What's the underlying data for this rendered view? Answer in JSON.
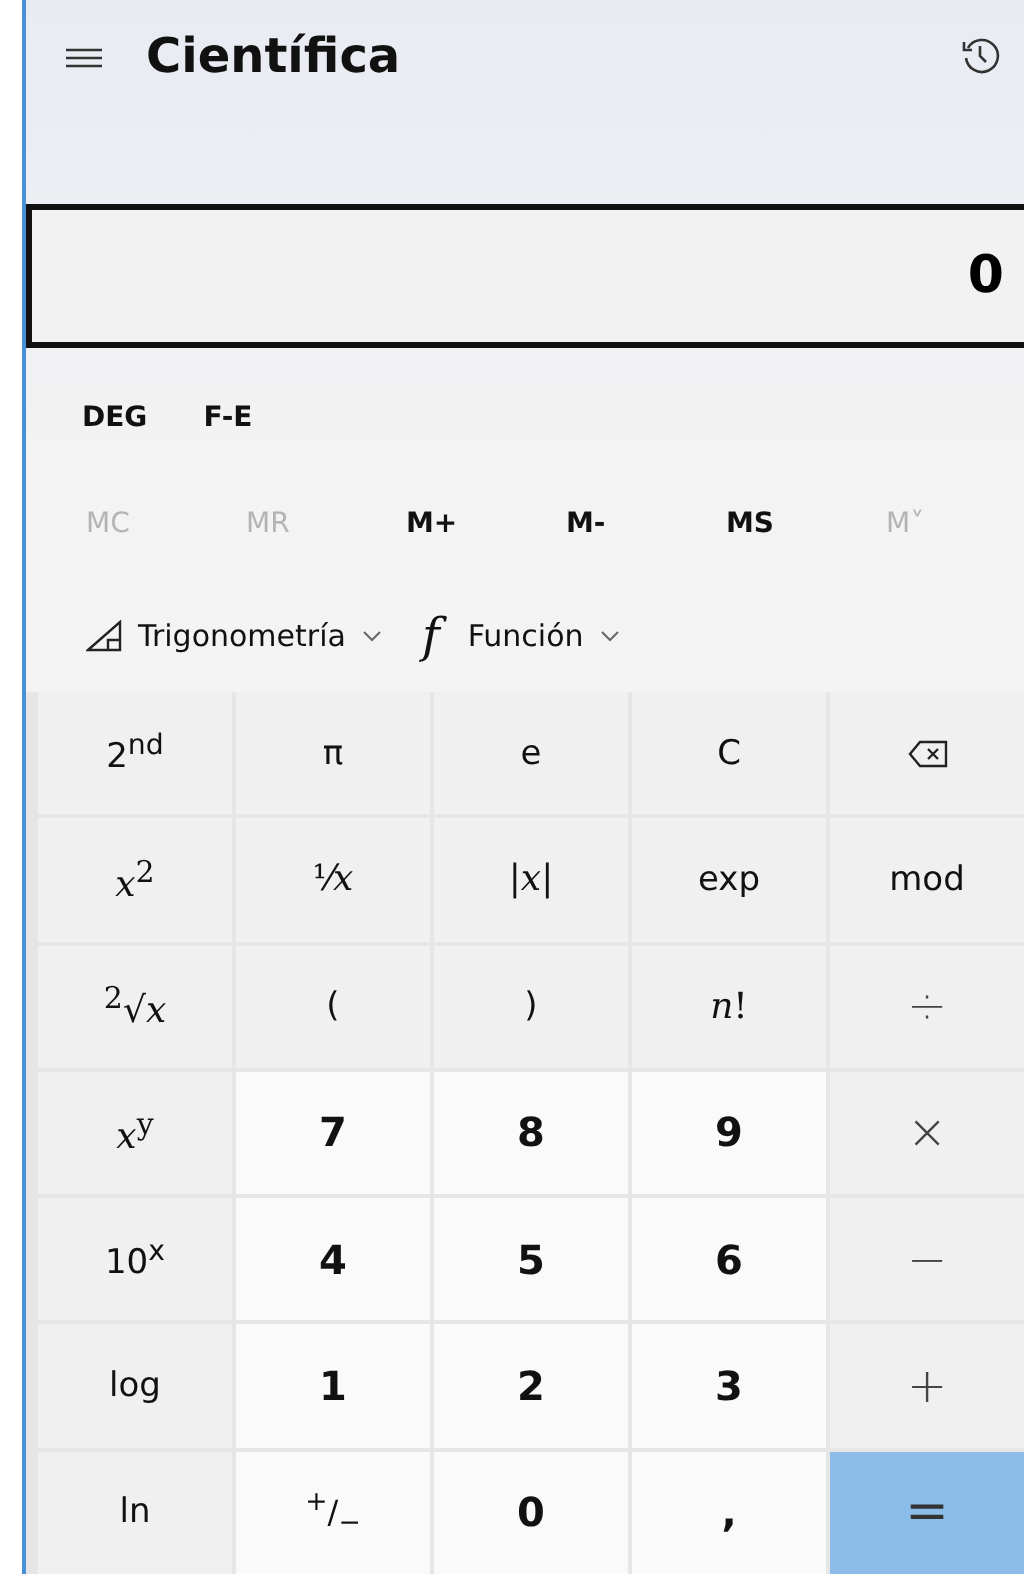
{
  "header": {
    "title": "Científica"
  },
  "display": {
    "value": "0"
  },
  "modes": [
    "DEG",
    "F-E"
  ],
  "memory": [
    {
      "label": "MC",
      "disabled": true
    },
    {
      "label": "MR",
      "disabled": true
    },
    {
      "label": "M+",
      "disabled": false
    },
    {
      "label": "M-",
      "disabled": false
    },
    {
      "label": "MS",
      "disabled": false
    },
    {
      "label": "M˅",
      "disabled": true
    }
  ],
  "dropdowns": [
    {
      "kind": "trig",
      "label": "Trigonometría"
    },
    {
      "kind": "func",
      "glyph": "f",
      "label": "Función"
    }
  ],
  "keys": [
    {
      "kind": "fn",
      "label": "2$^{nd}$"
    },
    {
      "kind": "fn",
      "label": "π"
    },
    {
      "kind": "fn",
      "label": "e"
    },
    {
      "kind": "fn",
      "label": "C"
    },
    {
      "kind": "backspace"
    },
    {
      "kind": "fn",
      "label": "*x*$^{2}$",
      "math": true
    },
    {
      "kind": "fn",
      "label": "¹⁄*x*",
      "math": true
    },
    {
      "kind": "fn",
      "label": "|*x*|",
      "math": true
    },
    {
      "kind": "fn",
      "label": "exp"
    },
    {
      "kind": "fn",
      "label": "mod"
    },
    {
      "kind": "fn",
      "label": "$^{2}$√*x*",
      "math": true
    },
    {
      "kind": "fn",
      "label": "("
    },
    {
      "kind": "fn",
      "label": ")"
    },
    {
      "kind": "fn",
      "label": "*n*!",
      "math": true
    },
    {
      "kind": "op",
      "label": "÷"
    },
    {
      "kind": "fn",
      "label": "*x*$^{y}$",
      "math": true
    },
    {
      "kind": "digit",
      "label": "7"
    },
    {
      "kind": "digit",
      "label": "8"
    },
    {
      "kind": "digit",
      "label": "9"
    },
    {
      "kind": "op",
      "label": "×"
    },
    {
      "kind": "fn",
      "label": "10$^{x}$"
    },
    {
      "kind": "digit",
      "label": "4"
    },
    {
      "kind": "digit",
      "label": "5"
    },
    {
      "kind": "digit",
      "label": "6"
    },
    {
      "kind": "op",
      "label": "−"
    },
    {
      "kind": "fn",
      "label": "log"
    },
    {
      "kind": "digit",
      "label": "1"
    },
    {
      "kind": "digit",
      "label": "2"
    },
    {
      "kind": "digit",
      "label": "3"
    },
    {
      "kind": "op",
      "label": "+"
    },
    {
      "kind": "fn",
      "label": "ln"
    },
    {
      "kind": "sign",
      "label": "$^{+}$/$_{−}$"
    },
    {
      "kind": "digit",
      "label": "0"
    },
    {
      "kind": "digit",
      "label": ","
    },
    {
      "kind": "equals",
      "label": "="
    }
  ]
}
